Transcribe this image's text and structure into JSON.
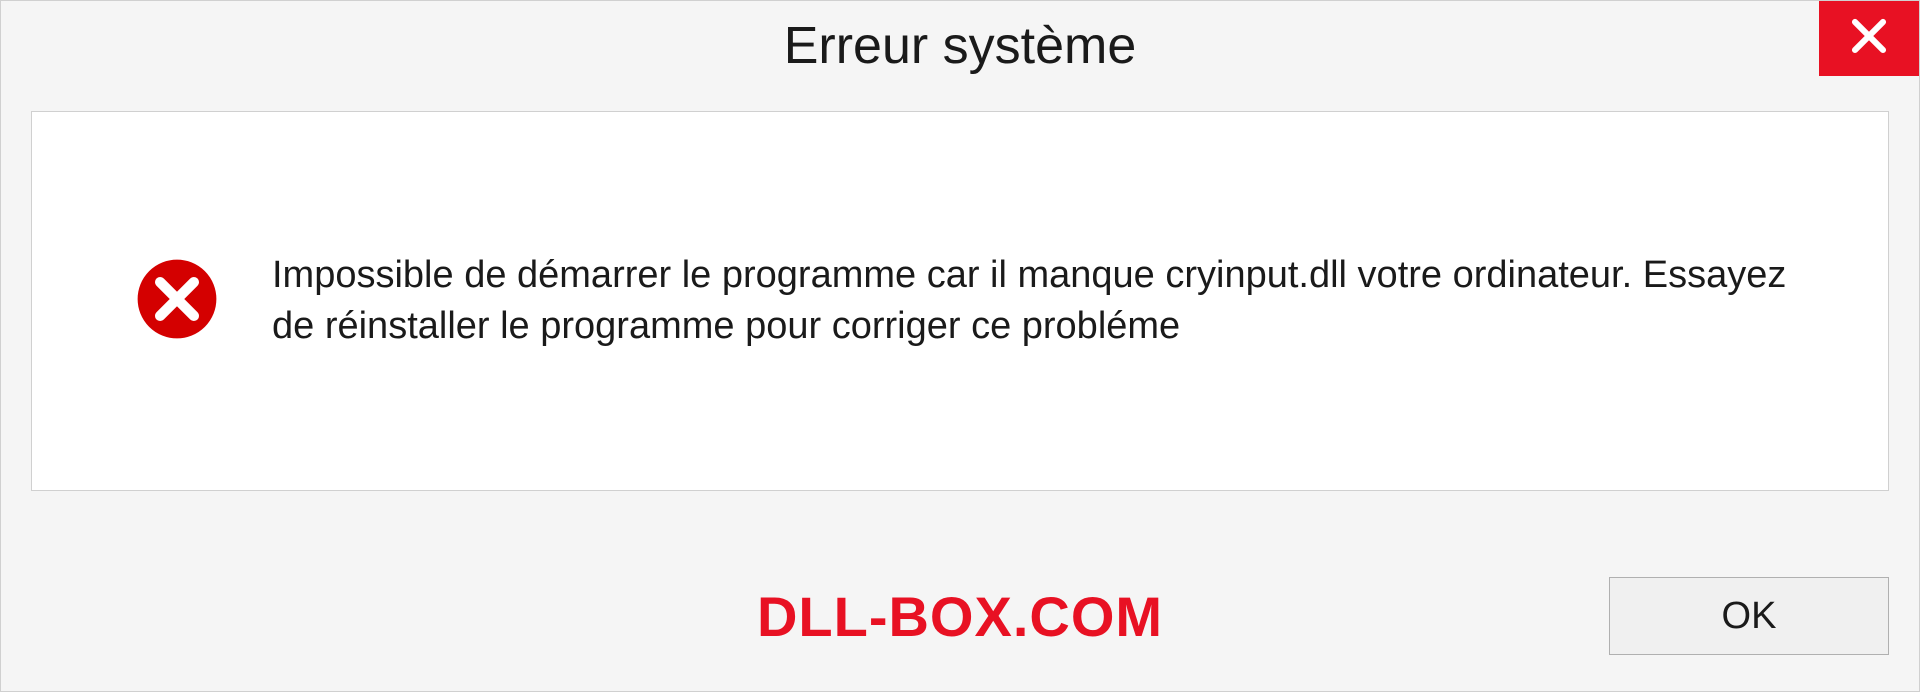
{
  "dialog": {
    "title": "Erreur système",
    "message": "Impossible de démarrer le programme car il manque cryinput.dll votre ordinateur. Essayez de réinstaller le programme pour corriger ce probléme",
    "ok_label": "OK",
    "watermark": "DLL-BOX.COM"
  },
  "colors": {
    "close_bg": "#e81123",
    "error_fill": "#d40000",
    "watermark": "#e81123"
  }
}
